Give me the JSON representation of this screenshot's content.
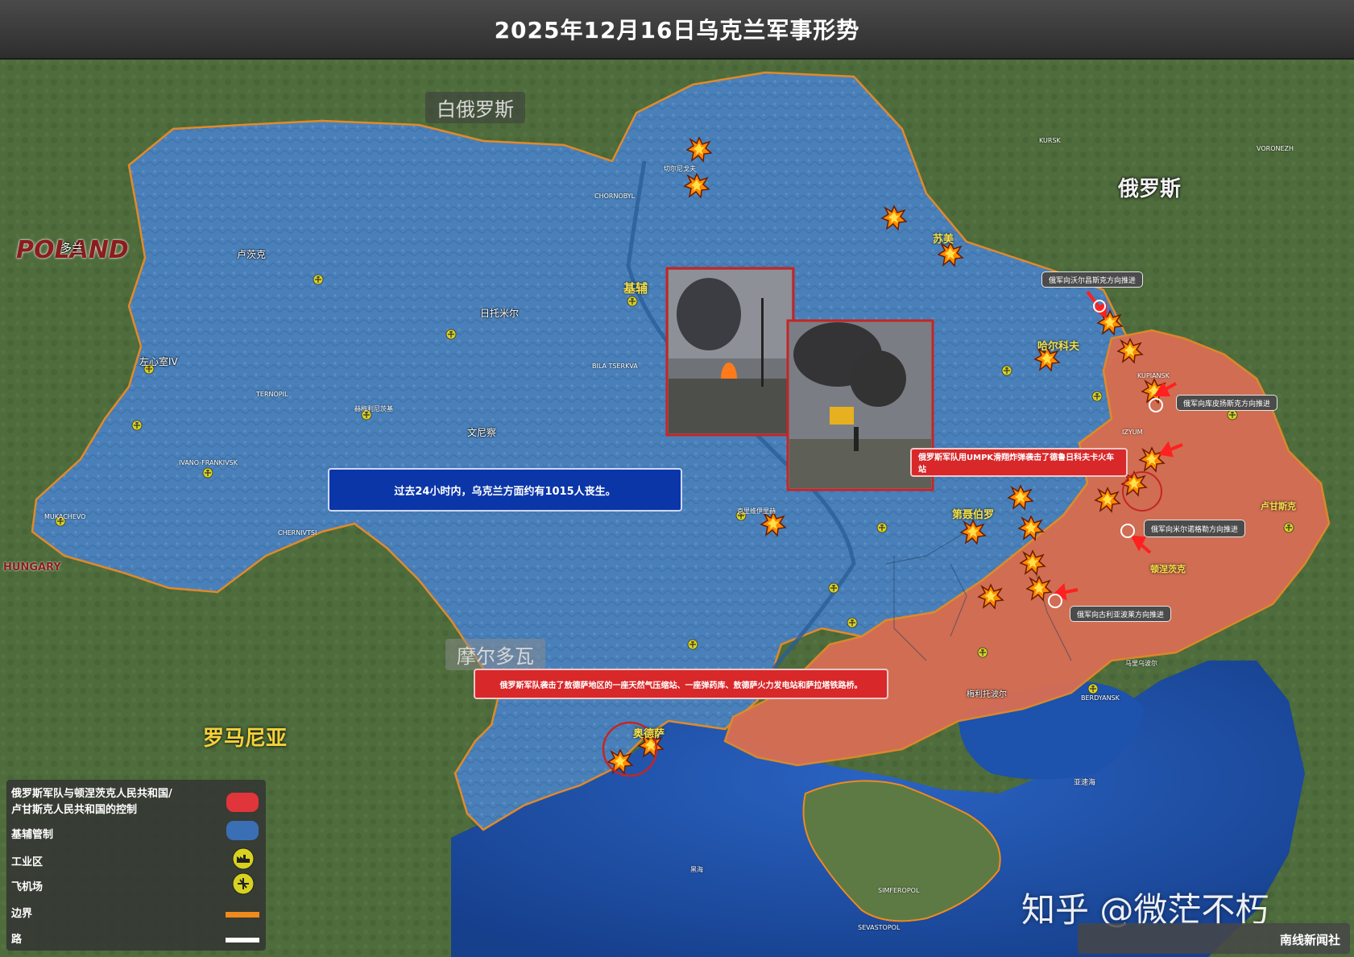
{
  "title": "2025年12月16日乌克兰军事形势",
  "countries": {
    "belarus": "白俄罗斯",
    "russia": "俄罗斯",
    "poland_logo": "POLAND",
    "poland": "多兰",
    "moldova": "摩尔多瓦",
    "romania": "罗马尼亚",
    "hungary_logo": "HUNGARY"
  },
  "cities": {
    "kyiv": "基辅",
    "sumy": "苏美",
    "kharkiv": "哈尔科夫",
    "dnipro": "第聂伯罗",
    "odesa": "奥德萨",
    "donetsk": "顿涅茨克",
    "luhansk": "卢甘斯克",
    "lutsk": "卢茨克",
    "lviv": "左心室IV",
    "zhytomyr": "日托米尔",
    "vinnytsia": "文尼察",
    "chernihiv": "切尔尼戈夫",
    "khmelnytskyi": "赫梅利尼茨基",
    "kryvyi_rih": "克里维伊里赫",
    "melitopol": "梅利托波尔",
    "azov": "亚速海",
    "black_sea": "黑海",
    "ternopil": "TERNOPIL",
    "ivano_frankivsk": "IVANO-FRANKIVSK",
    "mukachevo": "MUKACHEVO",
    "chernivtsi": "CHERNIVTSI",
    "bila_tserkva": "BILA TSERKVA",
    "chornobyl": "CHORNOBYL",
    "kursk": "KURSK",
    "voronezh": "VORONEZH",
    "kupiansk": "KUPIANSK",
    "izyum": "IZYUM",
    "sevastopol": "SEVASTOPOL",
    "simferopol": "SIMFEROPOL",
    "berdyansk": "BERDYANSK",
    "mariupol": "马里乌波尔"
  },
  "banners": {
    "casualties": "过去24小时内，乌克兰方面约有1015人丧生。",
    "odesa_strike": "俄罗斯军队袭击了敖德萨地区的一座天然气压缩站、一座弹药库、敖德萨火力发电站和萨拉塔铁路桥。",
    "rail_strike": "俄罗斯军队用UMPK滑翔炸弹袭击了德鲁日科夫卡火车站"
  },
  "callouts": {
    "volchansk": "俄军向沃尔昌斯克方向推进",
    "kupiansk": "俄军向库皮扬斯克方向推进",
    "siversk": "俄军向米尔诺格勒方向推进",
    "huliaipole": "俄军向古利亚波莱方向推进"
  },
  "legend": {
    "russian_control": "俄罗斯军队与顿涅茨克人民共和国/\n卢甘斯克人民共和国的控制",
    "kyiv_control": "基辅管制",
    "industrial": "工业区",
    "airport": "飞机场",
    "border": "边界",
    "road": "路",
    "colors": {
      "russian_control": "#e0353b",
      "kyiv_control": "#3a6fb5",
      "border": "#f08a1c",
      "road": "#ffffff"
    }
  },
  "watermark": "知乎 @微茫不朽",
  "source": "南线新闻社",
  "colors": {
    "ukraine_fill": "#4a7fb8",
    "occupied_fill": "#d86e54",
    "sea": "#1d4fa6",
    "land": "#4d6a3f"
  }
}
